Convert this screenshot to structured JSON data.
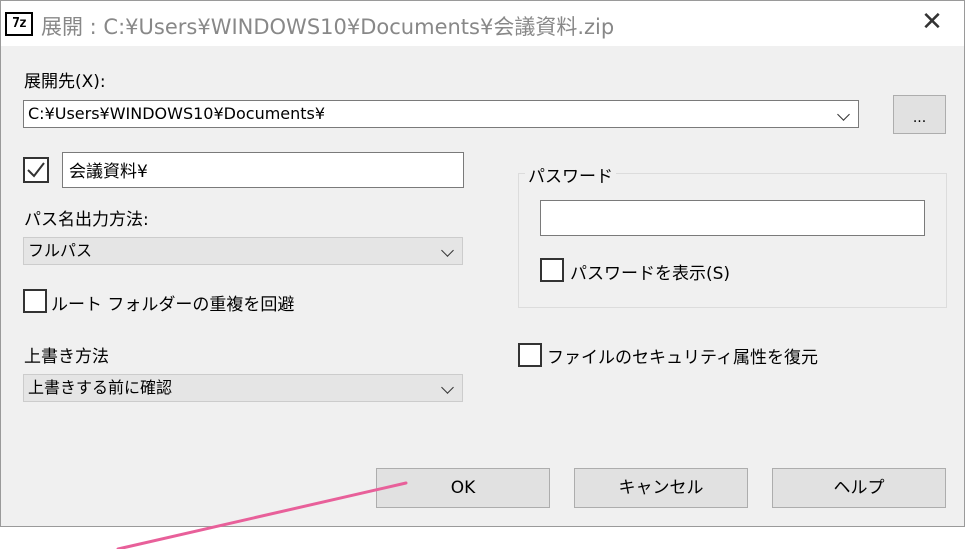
{
  "window": {
    "title": "展開 : C:¥Users¥WINDOWS10¥Documents¥会議資料.zip",
    "icon_text": "7z",
    "close_glyph": "✕"
  },
  "extract_to": {
    "label": "展開先(X):",
    "path_value": "C:¥Users¥WINDOWS10¥Documents¥",
    "browse_label": "..."
  },
  "subfolder": {
    "checked": true,
    "value": "会議資料¥"
  },
  "path_mode": {
    "label": "パス名出力方法:",
    "selected": "フルパス"
  },
  "eliminate_duplication": {
    "label": "ルート フォルダーの重複を回避",
    "checked": false
  },
  "overwrite_mode": {
    "label": "上書き方法",
    "selected": "上書きする前に確認"
  },
  "password": {
    "group_title": "パスワード",
    "value": "",
    "show_label": "パスワードを表示(S)",
    "show_checked": false
  },
  "restore_security": {
    "label": "ファイルのセキュリティ属性を復元",
    "checked": false
  },
  "buttons": {
    "ok": "OK",
    "cancel": "キャンセル",
    "help": "ヘルプ"
  },
  "colors": {
    "annotation_line": "#e8609a",
    "dialog_bg": "#f0f0f0"
  }
}
